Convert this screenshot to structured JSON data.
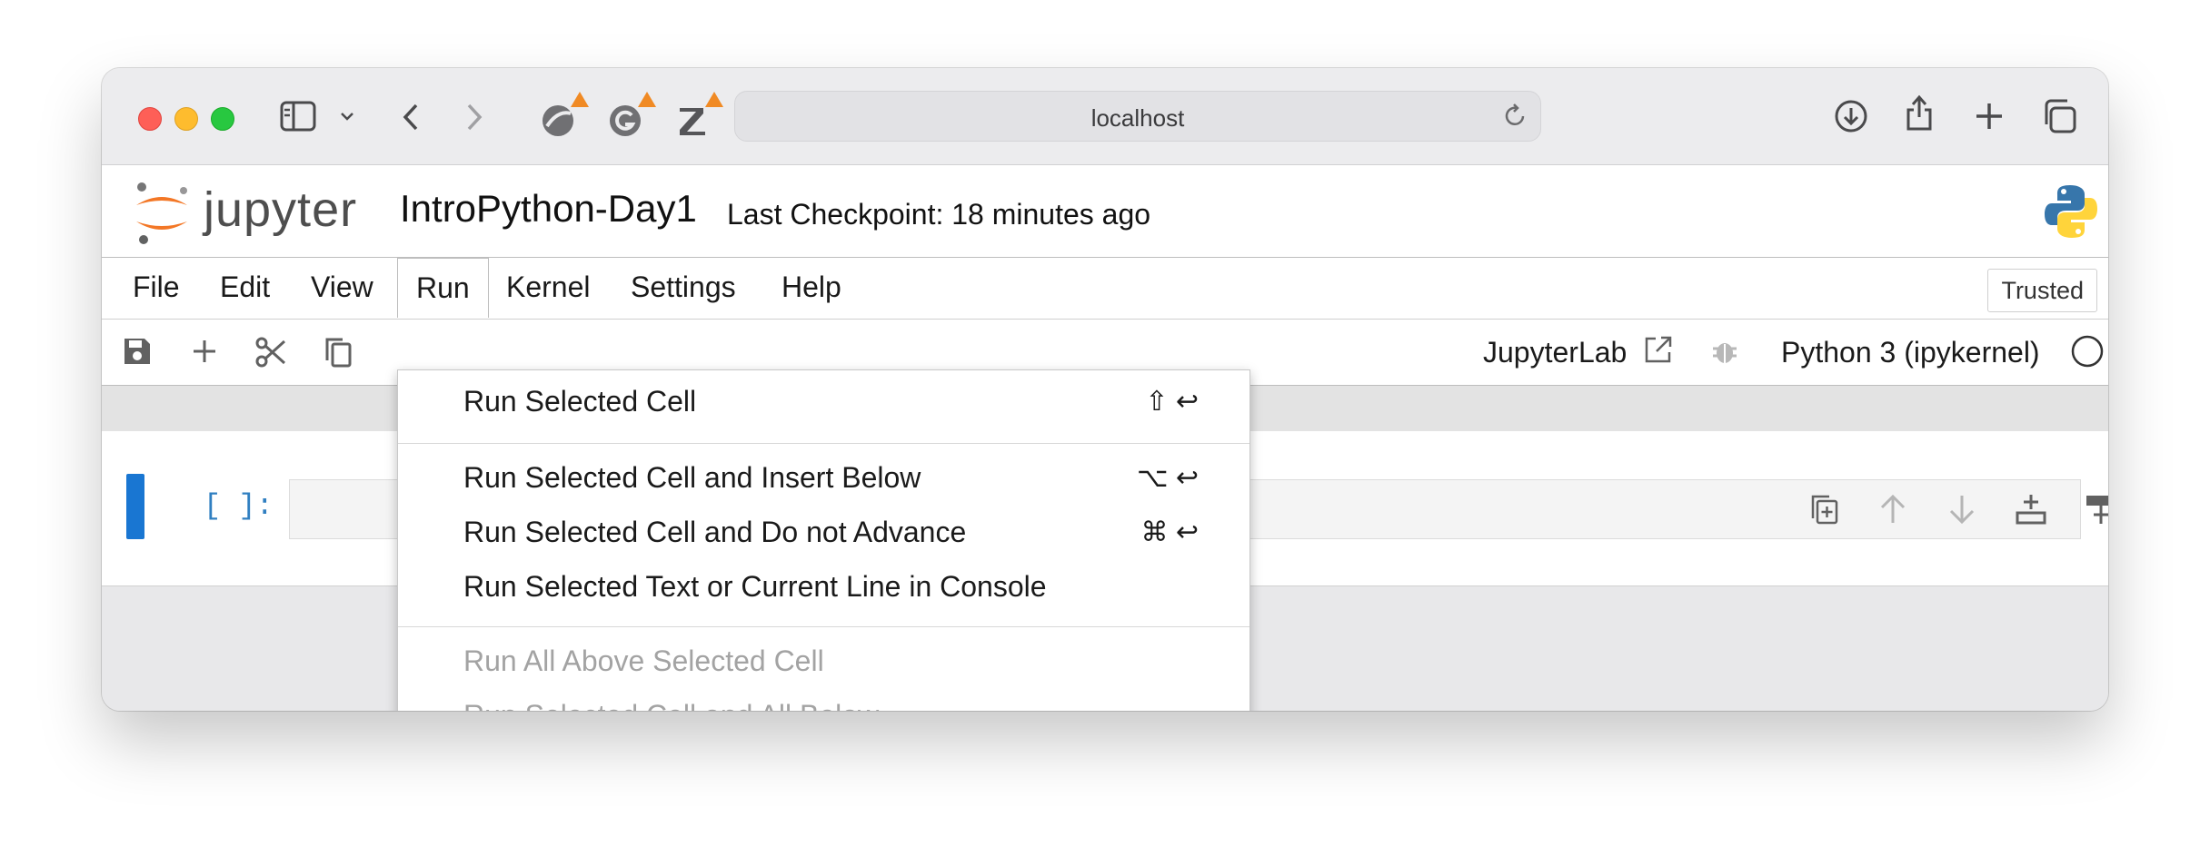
{
  "browser": {
    "url": "localhost"
  },
  "notebook": {
    "logo_text": "jupyter",
    "title": "IntroPython-Day1",
    "checkpoint": "Last Checkpoint: 18 minutes ago"
  },
  "menubar": {
    "items": [
      "File",
      "Edit",
      "View",
      "Run",
      "Kernel",
      "Settings",
      "Help"
    ],
    "trusted": "Trusted"
  },
  "toolbar": {
    "jupyterlab_label": "JupyterLab",
    "kernel_name": "Python 3 (ipykernel)"
  },
  "cell": {
    "prompt": "[ ]:"
  },
  "run_menu": {
    "items": [
      {
        "label": "Run Selected Cell",
        "shortcut": "⇧ ↩"
      },
      {
        "label": "Run Selected Cell and Insert Below",
        "shortcut": "⌥ ↩"
      },
      {
        "label": "Run Selected Cell and Do not Advance",
        "shortcut": "⌘ ↩"
      },
      {
        "label": "Run Selected Text or Current Line in Console",
        "shortcut": ""
      },
      {
        "label": "Run All Above Selected Cell",
        "shortcut": ""
      },
      {
        "label": "Run Selected Cell and All Below",
        "shortcut": ""
      }
    ]
  },
  "colors": {
    "accent": "#1976d2",
    "prompt": "#307fc1",
    "jupyter_orange": "#f37726",
    "warning_badge": "#f08a24"
  }
}
